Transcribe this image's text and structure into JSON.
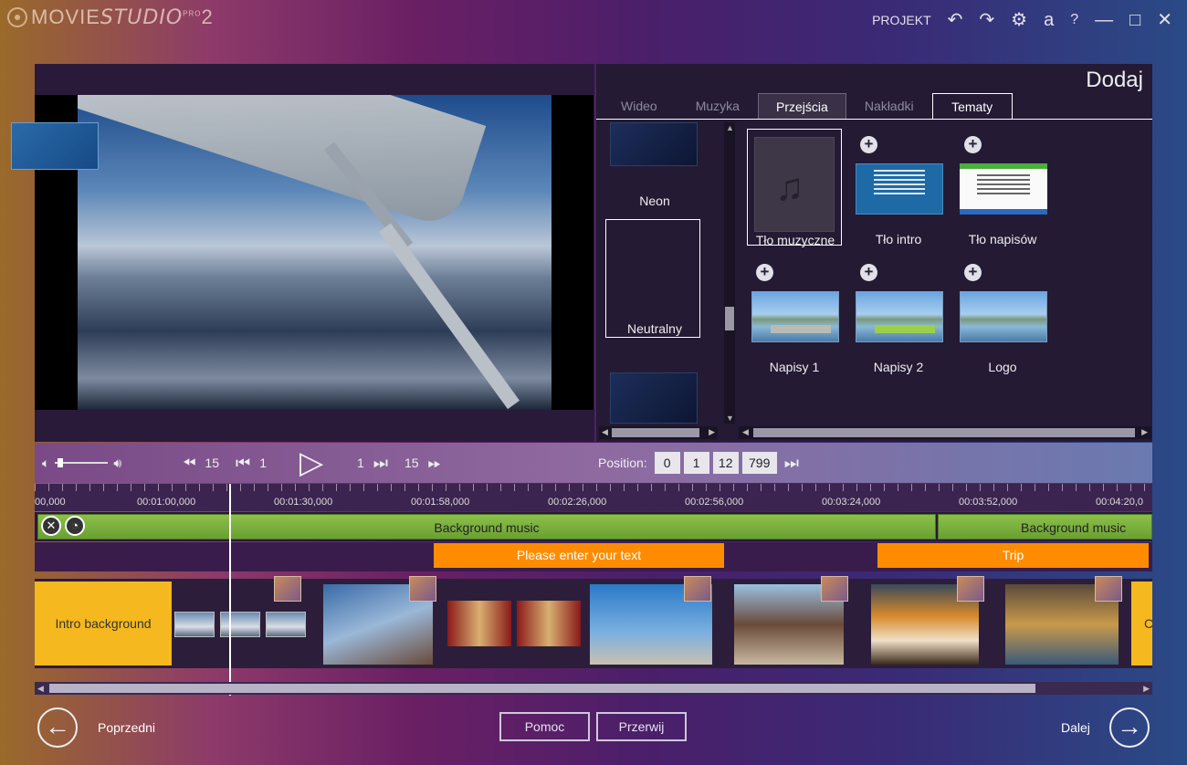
{
  "app": {
    "logo_movie": "MOVIE",
    "logo_studio": "STUDIO",
    "logo_pro": "PRO",
    "logo_version": "2",
    "menu_project": "PROJEKT",
    "icons": [
      "undo-icon",
      "redo-icon",
      "gear-icon",
      "amazon-icon",
      "help-icon",
      "minimize-icon",
      "maximize-icon",
      "close-icon"
    ],
    "amazon_glyph": "a",
    "help_glyph": "?"
  },
  "add_panel": {
    "title": "Dodaj",
    "tabs": [
      {
        "label": "Wideo"
      },
      {
        "label": "Muzyka"
      },
      {
        "label": "Przejścia"
      },
      {
        "label": "Nakładki"
      },
      {
        "label": "Tematy"
      }
    ],
    "themes": [
      {
        "label": "Neon"
      },
      {
        "label": "Neutralny"
      }
    ],
    "tiles": [
      {
        "label": "Tło muzyczne"
      },
      {
        "label": "Tło intro"
      },
      {
        "label": "Tło napisów"
      },
      {
        "label": "Napisy 1"
      },
      {
        "label": "Napisy 2"
      },
      {
        "label": "Logo"
      }
    ]
  },
  "player": {
    "skip_back_big": "15",
    "skip_back_small": "1",
    "skip_fwd_small": "1",
    "skip_fwd_big": "15",
    "position_label": "Position:",
    "position": {
      "h": "0",
      "m": "1",
      "s": "12",
      "ms": "799"
    },
    "volume_level": 0.05
  },
  "timeline": {
    "ticks": [
      "00,000",
      "00:01:00,000",
      "00:01:30,000",
      "00:01:58,000",
      "00:02:26,000",
      "00:02:56,000",
      "00:03:24,000",
      "00:03:52,000",
      "00:04:20,0"
    ],
    "music_clips": [
      {
        "label": "Background music"
      },
      {
        "label": "Background music"
      }
    ],
    "text_clips": [
      {
        "label": "Please enter your text"
      },
      {
        "label": "Trip"
      }
    ],
    "intro_label": "Intro background",
    "outro_label": "C"
  },
  "footer": {
    "prev": "Poprzedni",
    "help": "Pomoc",
    "cancel": "Przerwij",
    "next": "Dalej"
  }
}
